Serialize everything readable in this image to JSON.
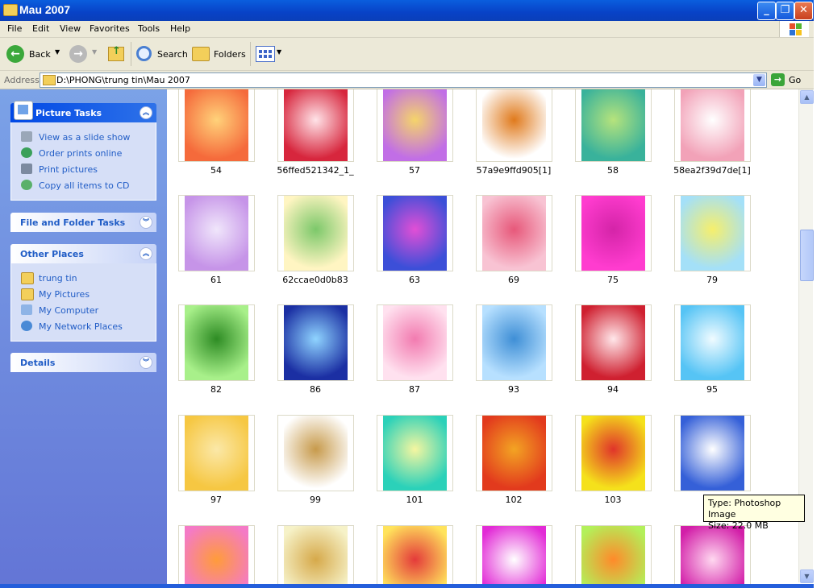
{
  "window": {
    "title": "Mau 2007"
  },
  "menu": [
    "File",
    "Edit",
    "View",
    "Favorites",
    "Tools",
    "Help"
  ],
  "toolbar": {
    "back": "Back",
    "search": "Search",
    "folders": "Folders"
  },
  "address": {
    "label": "Address",
    "path": "D:\\PHONG\\trung tin\\Mau 2007",
    "go": "Go"
  },
  "picture_tasks": {
    "title": "Picture Tasks",
    "items": [
      "View as a slide show",
      "Order prints online",
      "Print pictures",
      "Copy all items to CD"
    ]
  },
  "file_folder_tasks": {
    "title": "File and Folder Tasks"
  },
  "other_places": {
    "title": "Other Places",
    "items": [
      "trung tin",
      "My Pictures",
      "My Computer",
      "My Network Places"
    ]
  },
  "details": {
    "title": "Details"
  },
  "files": [
    {
      "name": "54",
      "c1": "#f56a3b",
      "c2": "#ffd27a"
    },
    {
      "name": "56ffed521342_1_",
      "c1": "#d7263d",
      "c2": "#ffe3e8"
    },
    {
      "name": "57",
      "c1": "#c16ee6",
      "c2": "#f5d46a"
    },
    {
      "name": "57a9e9ffd905[1]",
      "c1": "#ffffff",
      "c2": "#e07a1c"
    },
    {
      "name": "58",
      "c1": "#39b29b",
      "c2": "#b6e37c"
    },
    {
      "name": "58ea2f39d7de[1]",
      "c1": "#f2a2b8",
      "c2": "#ffffff"
    },
    {
      "name": "61",
      "c1": "#c694e8",
      "c2": "#f0e6fb"
    },
    {
      "name": "62ccae0d0b83",
      "c1": "#fff5c2",
      "c2": "#7cc86a"
    },
    {
      "name": "63",
      "c1": "#3c4fd8",
      "c2": "#e24fd6"
    },
    {
      "name": "69",
      "c1": "#f8c3d3",
      "c2": "#e7587a"
    },
    {
      "name": "75",
      "c1": "#ff3ccf",
      "c2": "#d424a8"
    },
    {
      "name": "79",
      "c1": "#a4e0f8",
      "c2": "#f6ef6c"
    },
    {
      "name": "82",
      "c1": "#a8f08a",
      "c2": "#2e8c24"
    },
    {
      "name": "86",
      "c1": "#1b2fa3",
      "c2": "#8fd4ff"
    },
    {
      "name": "87",
      "c1": "#ffe1ef",
      "c2": "#f27bb0"
    },
    {
      "name": "93",
      "c1": "#b7e0ff",
      "c2": "#3f8fd6"
    },
    {
      "name": "94",
      "c1": "#cf2030",
      "c2": "#ffe7ea"
    },
    {
      "name": "95",
      "c1": "#56c4f5",
      "c2": "#f0fbff"
    },
    {
      "name": "97",
      "c1": "#f6c742",
      "c2": "#fbe8a8"
    },
    {
      "name": "99",
      "c1": "#ffffff",
      "c2": "#c79a4b"
    },
    {
      "name": "101",
      "c1": "#2bd1b9",
      "c2": "#f6f6a0"
    },
    {
      "name": "102",
      "c1": "#e23a1d",
      "c2": "#f3a423"
    },
    {
      "name": "103",
      "c1": "#f5e11b",
      "c2": "#e0342a"
    },
    {
      "name": "",
      "c1": "#3560d8",
      "c2": "#ffffff"
    },
    {
      "name": "",
      "c1": "#f47ac6",
      "c2": "#ff9c3a"
    },
    {
      "name": "",
      "c1": "#f6f2c8",
      "c2": "#d6a94a"
    },
    {
      "name": "",
      "c1": "#ffe35c",
      "c2": "#e43a3a"
    },
    {
      "name": "",
      "c1": "#e22bd6",
      "c2": "#ffffff"
    },
    {
      "name": "",
      "c1": "#b3f05a",
      "c2": "#ff8a2a"
    },
    {
      "name": "",
      "c1": "#d21ea8",
      "c2": "#ffd8f0"
    }
  ],
  "tooltip": {
    "type": "Type: Photoshop Image",
    "size": "Size: 22.0 MB"
  }
}
